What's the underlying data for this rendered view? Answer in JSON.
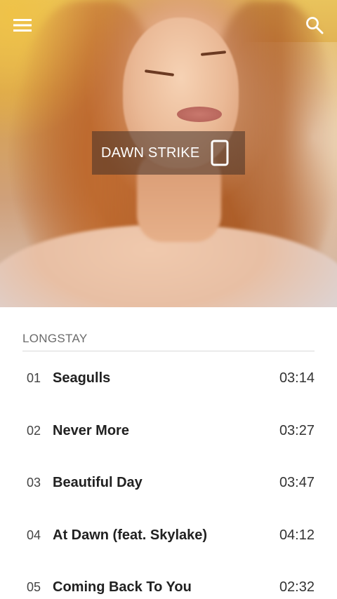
{
  "header": {
    "menu_icon": "hamburger-menu-icon",
    "search_icon": "search-icon",
    "artist_name": "DAWN STRIKE",
    "device_icon": "smartphone-icon"
  },
  "album": {
    "title": "LONGSTAY"
  },
  "tracks": [
    {
      "number": "01",
      "title": "Seagulls",
      "duration": "03:14"
    },
    {
      "number": "02",
      "title": "Never More",
      "duration": "03:27"
    },
    {
      "number": "03",
      "title": "Beautiful Day",
      "duration": "03:47"
    },
    {
      "number": "04",
      "title": "At Dawn (feat. Skylake)",
      "duration": "04:12"
    },
    {
      "number": "05",
      "title": "Coming Back To You",
      "duration": "02:32"
    }
  ],
  "colors": {
    "badge_bg": "#46322888",
    "text_primary": "#212121",
    "text_secondary": "#6b6b6b",
    "divider": "#d9d9d9"
  }
}
